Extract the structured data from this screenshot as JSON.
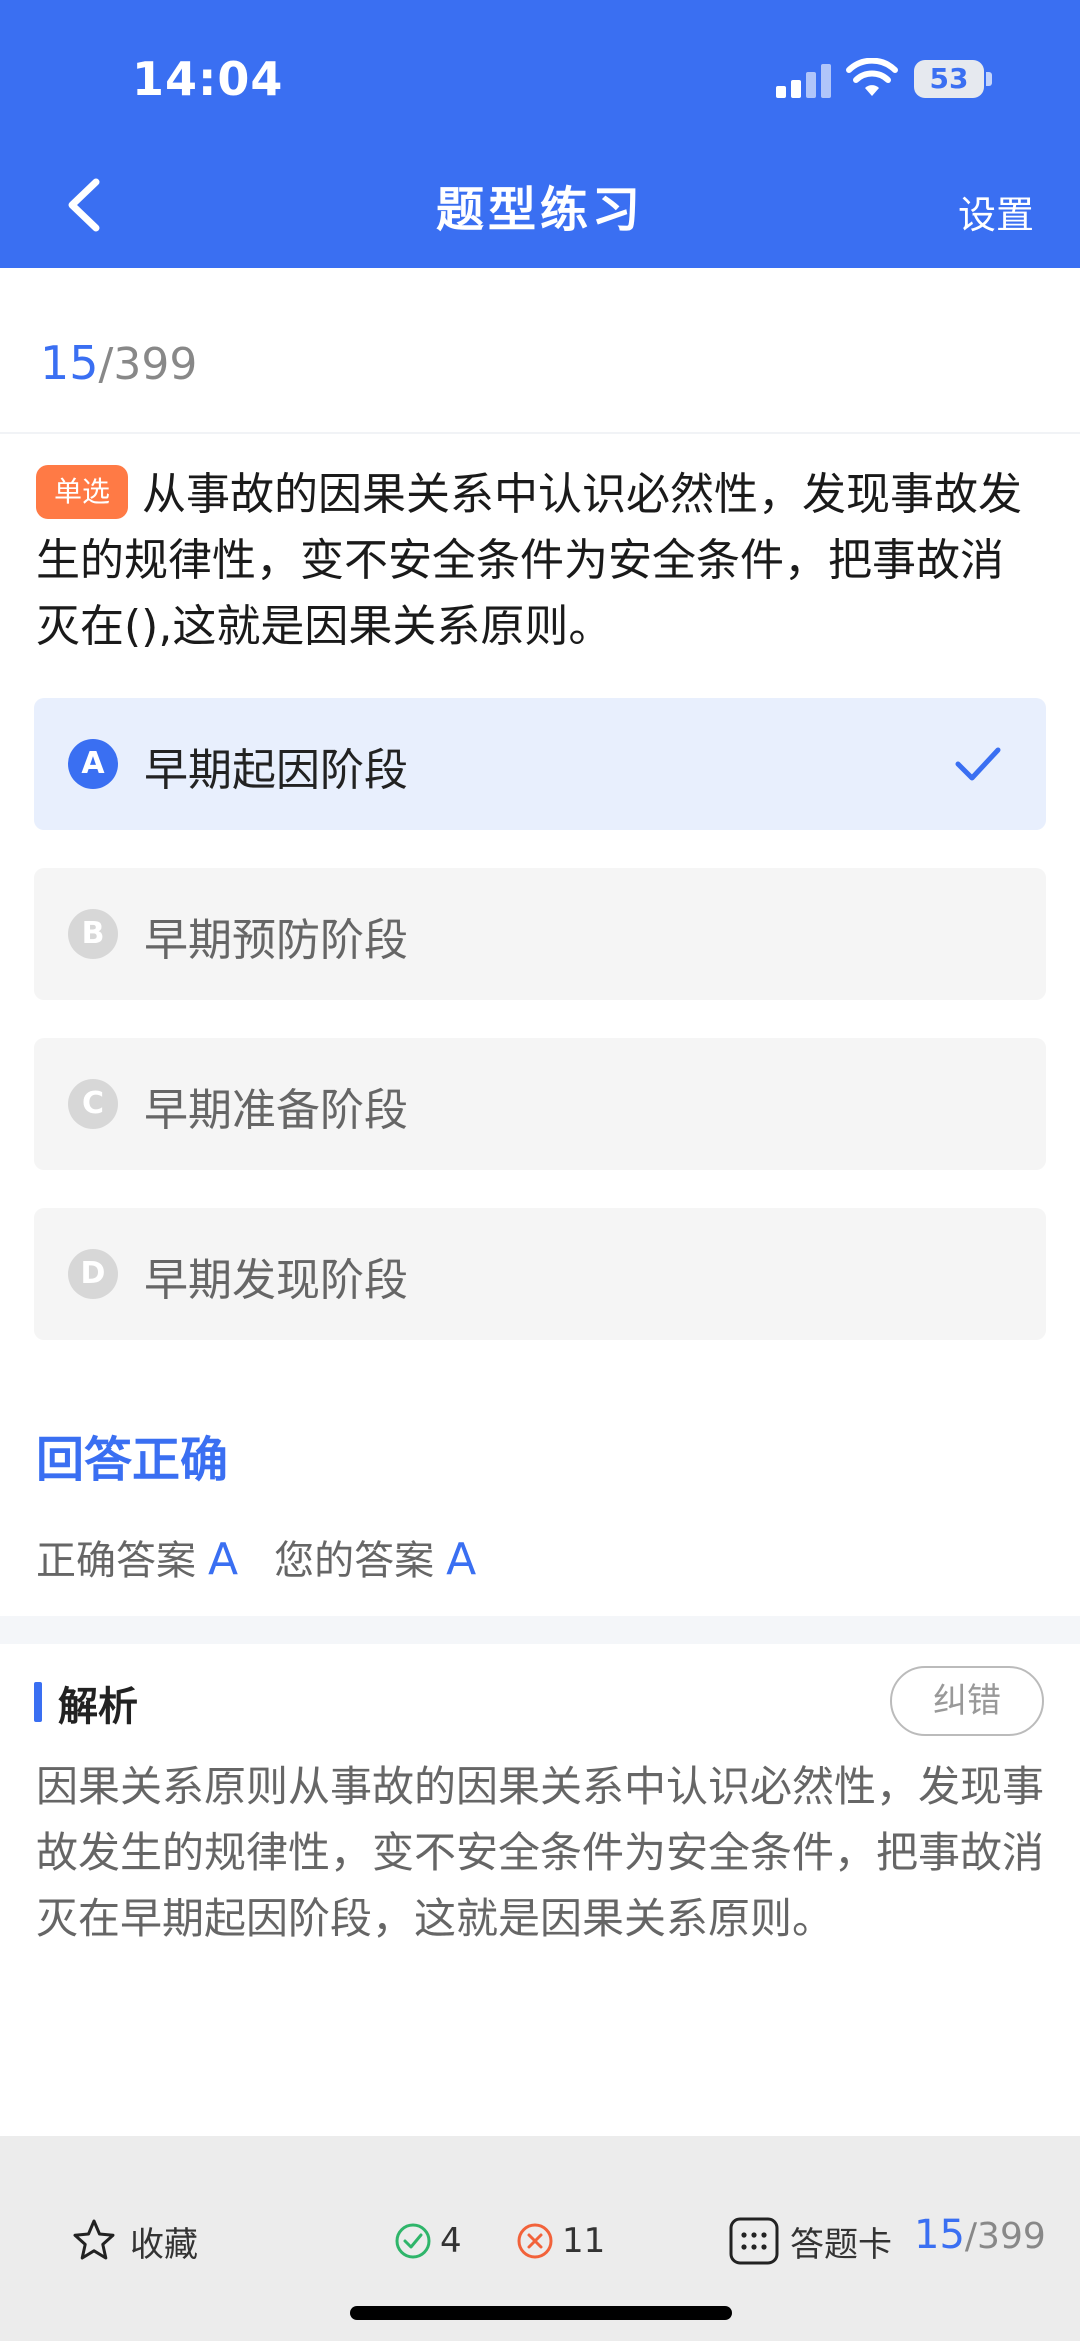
{
  "status_bar": {
    "time": "14:04",
    "battery": "53"
  },
  "nav": {
    "title": "题型练习",
    "settings_label": "设置"
  },
  "progress": {
    "current": "15",
    "total": "/399"
  },
  "question": {
    "type_badge": "单选",
    "text": "从事故的因果关系中认识必然性，发现事故发生的规律性，变不安全条件为安全条件，把事故消灭在(),这就是因果关系原则。"
  },
  "options": [
    {
      "letter": "A",
      "text": "早期起因阶段",
      "selected": true
    },
    {
      "letter": "B",
      "text": "早期预防阶段",
      "selected": false
    },
    {
      "letter": "C",
      "text": "早期准备阶段",
      "selected": false
    },
    {
      "letter": "D",
      "text": "早期发现阶段",
      "selected": false
    }
  ],
  "result": {
    "title": "回答正确",
    "correct_label": "正确答案",
    "correct_value": "A",
    "your_label": "您的答案",
    "your_value": "A"
  },
  "analysis": {
    "title": "解析",
    "report_label": "纠错",
    "text": "因果关系原则从事故的因果关系中认识必然性，发现事故发生的规律性，变不安全条件为安全条件，把事故消灭在早期起因阶段，这就是因果关系原则。"
  },
  "bottom_bar": {
    "favorite_label": "收藏",
    "right_count": "4",
    "wrong_count": "11",
    "answer_card_label": "答题卡",
    "progress_current": "15",
    "progress_total": "/399"
  },
  "colors": {
    "accent": "#3a6ff2",
    "badge": "#ff7a45",
    "correct": "#2fb56a",
    "wrong": "#f2623a"
  }
}
